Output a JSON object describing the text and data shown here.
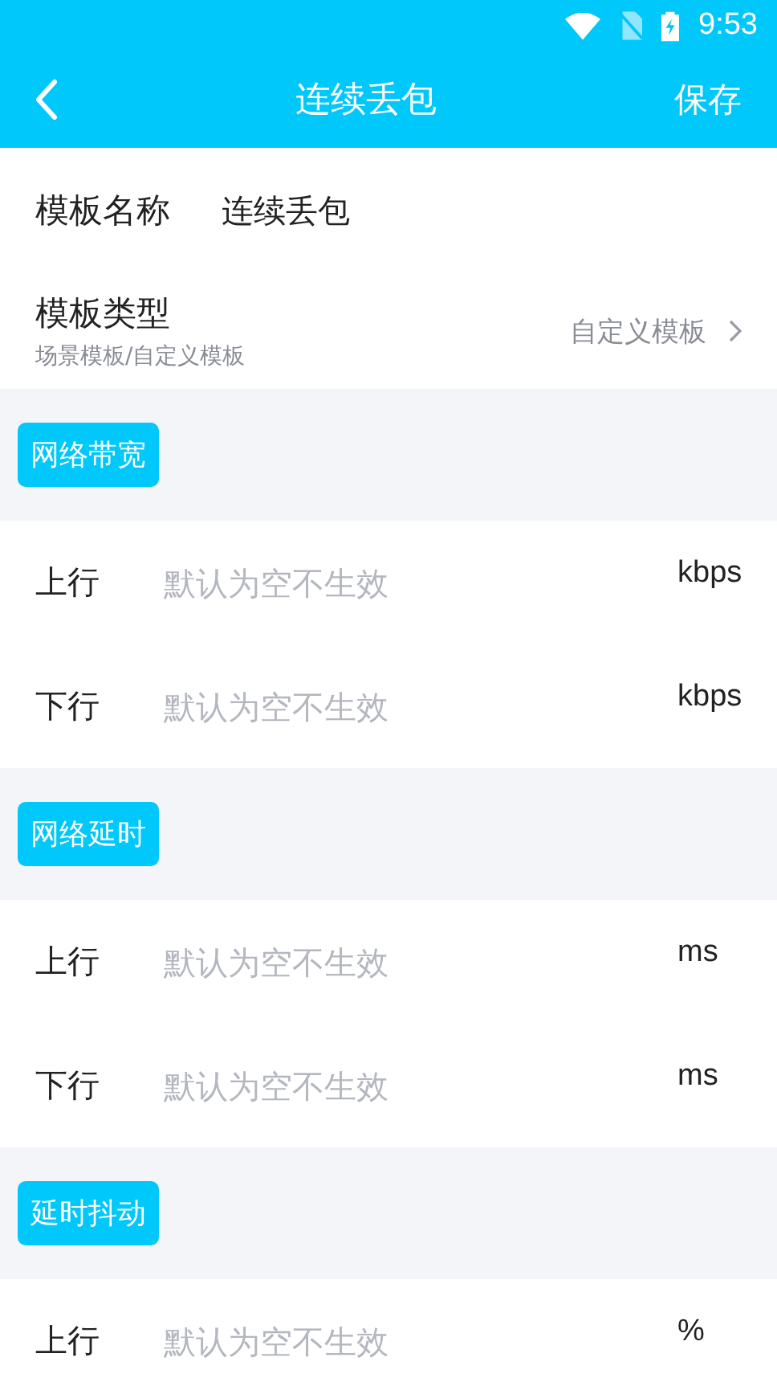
{
  "status_bar": {
    "time": "9:53"
  },
  "app_bar": {
    "title": "连续丢包",
    "action": "保存"
  },
  "template_name": {
    "label": "模板名称",
    "value": "连续丢包"
  },
  "template_type": {
    "label": "模板类型",
    "hint": "场景模板/自定义模板",
    "value": "自定义模板"
  },
  "sections": [
    {
      "title": "网络带宽",
      "rows": [
        {
          "label": "上行",
          "placeholder": "默认为空不生效",
          "unit": "kbps"
        },
        {
          "label": "下行",
          "placeholder": "默认为空不生效",
          "unit": "kbps"
        }
      ]
    },
    {
      "title": "网络延时",
      "rows": [
        {
          "label": "上行",
          "placeholder": "默认为空不生效",
          "unit": "ms"
        },
        {
          "label": "下行",
          "placeholder": "默认为空不生效",
          "unit": "ms"
        }
      ]
    },
    {
      "title": "延时抖动",
      "rows": [
        {
          "label": "上行",
          "placeholder": "默认为空不生效",
          "unit": "%"
        }
      ]
    }
  ]
}
